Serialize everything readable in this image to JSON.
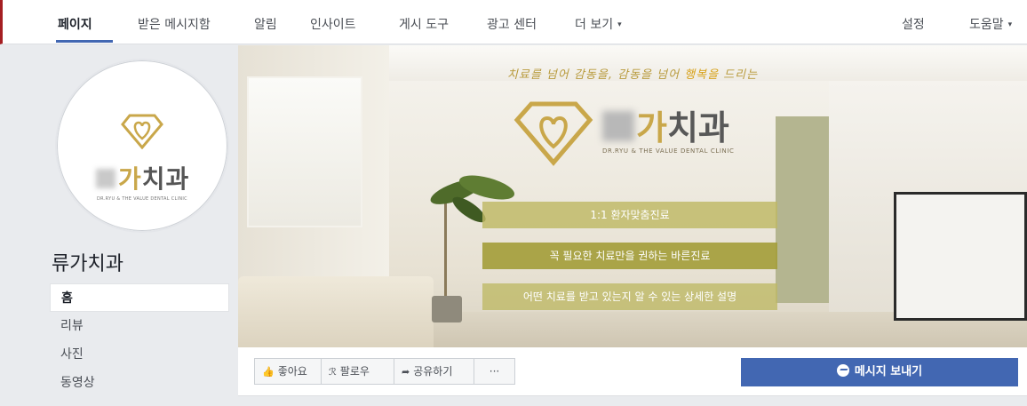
{
  "topnav": {
    "items": [
      "페이지",
      "받은 메시지함",
      "알림",
      "인사이트",
      "게시 도구",
      "광고 센터",
      "더 보기"
    ],
    "right_items": [
      "설정",
      "도움말"
    ],
    "more_caret": "▾",
    "help_caret": "▾"
  },
  "profile": {
    "brand_ga": "가",
    "brand_chigwa": "치과",
    "brand_tagline": "DR.RYU & THE VALUE DENTAL CLINIC"
  },
  "page_name": "류가치과",
  "left_nav": [
    "홈",
    "리뷰",
    "사진",
    "동영상"
  ],
  "cover": {
    "slogan_prefix": "치료를 넘어 감동을, 감동을 넘어 ",
    "slogan_highlight": "행복을",
    "slogan_suffix": " 드리는",
    "brand_ga": "가",
    "brand_chigwa": "치과",
    "brand_tagline": "DR.RYU & THE VALUE DENTAL CLINIC",
    "bars": [
      "1:1 환자맞춤진료",
      "꼭 필요한 치료만을 권하는 바른진료",
      "어떤 치료를 받고 있는지 알 수 있는 상세한 설명"
    ]
  },
  "actions": {
    "like": "좋아요",
    "follow": "팔로우",
    "share": "공유하기",
    "more": "···",
    "message": "메시지 보내기"
  },
  "colors": {
    "accent": "#4267b2",
    "gold": "#c9a74a",
    "olive_bar": "#a49e3c"
  }
}
